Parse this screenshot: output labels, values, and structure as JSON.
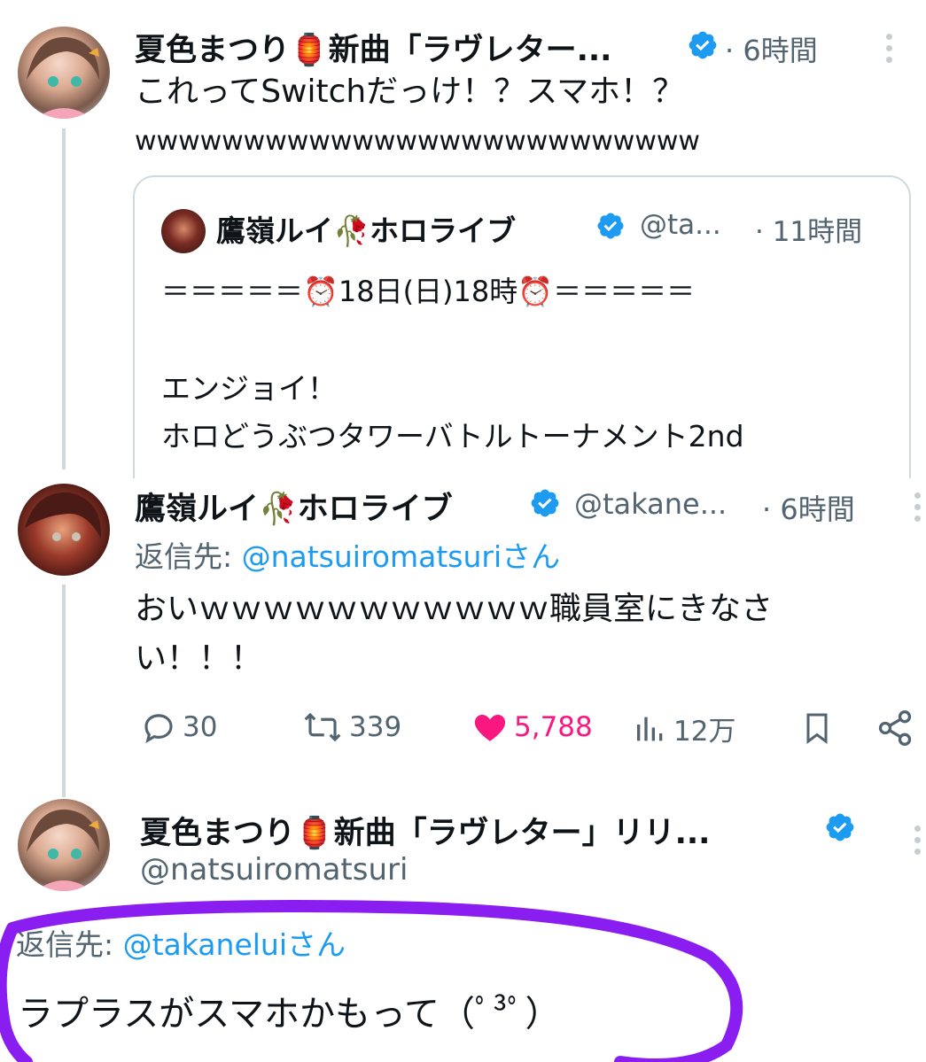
{
  "tweet1": {
    "display_name": "夏色まつり🏮新曲「ラヴレター...",
    "time": "· 6時間",
    "text_line1": "これってSwitchだっけ！？スマホ！？",
    "text_line2": "wwwwwwwwwwwwwwwwwwwwwwwwww",
    "quote": {
      "display_name": "鷹嶺ルイ🥀ホロライブ",
      "handle": "@ta...",
      "time": "· 11時間",
      "line1": "＝＝＝＝＝⏰18日(日)18時⏰＝＝＝＝＝",
      "line2": "エンジョイ！",
      "line3": "ホロどうぶつタワーバトルトーナメント2nd"
    }
  },
  "tweet2": {
    "display_name": "鷹嶺ルイ🥀ホロライブ",
    "handle": "@takane...",
    "time": "· 6時間",
    "reply_prefix": "返信先: ",
    "reply_to": "@natsuiromatsuriさん",
    "text_line1": "おいｗｗｗｗｗｗｗｗｗｗｗ職員室にきなさ",
    "text_line2": "い！！！",
    "actions": {
      "replies": "30",
      "retweets": "339",
      "likes": "5,788",
      "views": "12万"
    }
  },
  "tweet3": {
    "display_name": "夏色まつり🏮新曲「ラヴレター」リリ...",
    "handle": "@natsuiromatsuri",
    "reply_prefix": "返信先: ",
    "reply_to": "@takaneluiさん",
    "text": "ラプラスがスマホかもって（ﾟ³ﾟ）"
  },
  "colors": {
    "link": "#1d9bf0",
    "like": "#f91880",
    "verified": "#1d9bf0",
    "annotation": "#8a1df0"
  }
}
